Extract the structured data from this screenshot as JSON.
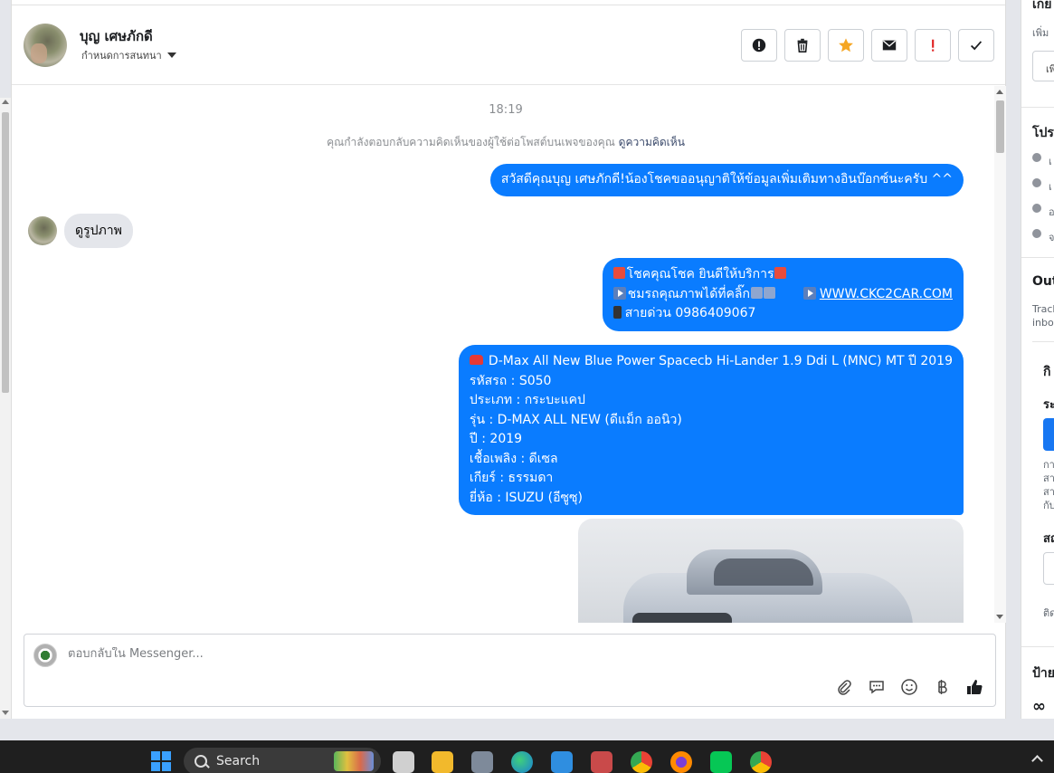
{
  "header": {
    "user_name": "บุญ เศษภักดี",
    "assign_label": "กำหนดการสนทนา",
    "actions": [
      {
        "icon": "alert-circle-icon"
      },
      {
        "icon": "trash-icon"
      },
      {
        "icon": "star-icon"
      },
      {
        "icon": "envelope-icon"
      },
      {
        "icon": "exclamation-icon"
      },
      {
        "icon": "check-icon"
      }
    ]
  },
  "chat": {
    "timestamp": "18:19",
    "context_text": "คุณกำลังตอบกลับความคิดเห็นของผู้ใช้ต่อโพสต์บนเพจของคุณ",
    "context_link": "ดูความคิดเห็น",
    "msg_greeting": "สวัสดีคุณบุญ เศษภักดี!น้องโชคขออนุญาติให้ข้อมูลเพิ่มเติมทางอินบ๊อกซ์นะครับ ^^",
    "msg_incoming": "ดูรูปภาพ",
    "msg_promo": {
      "line1": "โชคคุณโชค ยินดีให้บริการ",
      "line2_a": "ชมรถคุณภาพได้ที่คลิ๊ก",
      "line2_link": "WWW.CKC2CAR.COM",
      "line3": "สายด่วน 0986409067"
    },
    "msg_car": {
      "title": "D-Max All New Blue Power Spacecb Hi-Lander 1.9 Ddi L (MNC) MT ปี 2019",
      "code": "รหัสรถ : S050",
      "type": "ประเภท : กระบะแคป",
      "model": "รุ่น : D-MAX ALL NEW (ดีแม็ก ออนิว)",
      "year": "ปี : 2019",
      "fuel": "เชื้อเพลิง : ดีเซล",
      "gear": "เกียร์ : ธรรมดา",
      "brand": "ยี่ห้อ : ISUZU (อีซูซุ)"
    }
  },
  "composer": {
    "placeholder": "ตอบกลับใน Messenger...",
    "tools": [
      "paperclip-icon",
      "chat-bubble-icon",
      "emoji-icon",
      "baht-icon",
      "thumbs-up-icon"
    ]
  },
  "right_panel": {
    "heading_1": "เกย",
    "small_1": "เพิ่ม",
    "box_1": "เพิ",
    "heading_2": "โปร",
    "row_1": "เ",
    "row_2": "เ",
    "row_3": "อ",
    "row_4": "จ",
    "heading_3": "Out",
    "small_2a": "Track",
    "small_2b": "inbo",
    "heading_4": "กิ",
    "heading_5": "ระ",
    "small_3a": "กา",
    "small_3b": "สา",
    "small_3c": "สา",
    "small_3d": "กับ",
    "heading_6": "สถ",
    "small_4": "ติด",
    "heading_7": "ป้าย",
    "symbol": "∞"
  },
  "taskbar": {
    "search_label": "Search",
    "apps": [
      "file-explorer-icon",
      "folder-icon",
      "calculator-icon",
      "edge-icon",
      "store-icon",
      "snipping-icon",
      "chrome-icon",
      "firefox-icon",
      "line-icon",
      "chrome-profile-icon"
    ]
  },
  "colors": {
    "outgoing_bubble": "#0a7cff",
    "incoming_bubble": "#e4e6eb",
    "star": "#f5a623",
    "exclamation": "#e02424"
  }
}
